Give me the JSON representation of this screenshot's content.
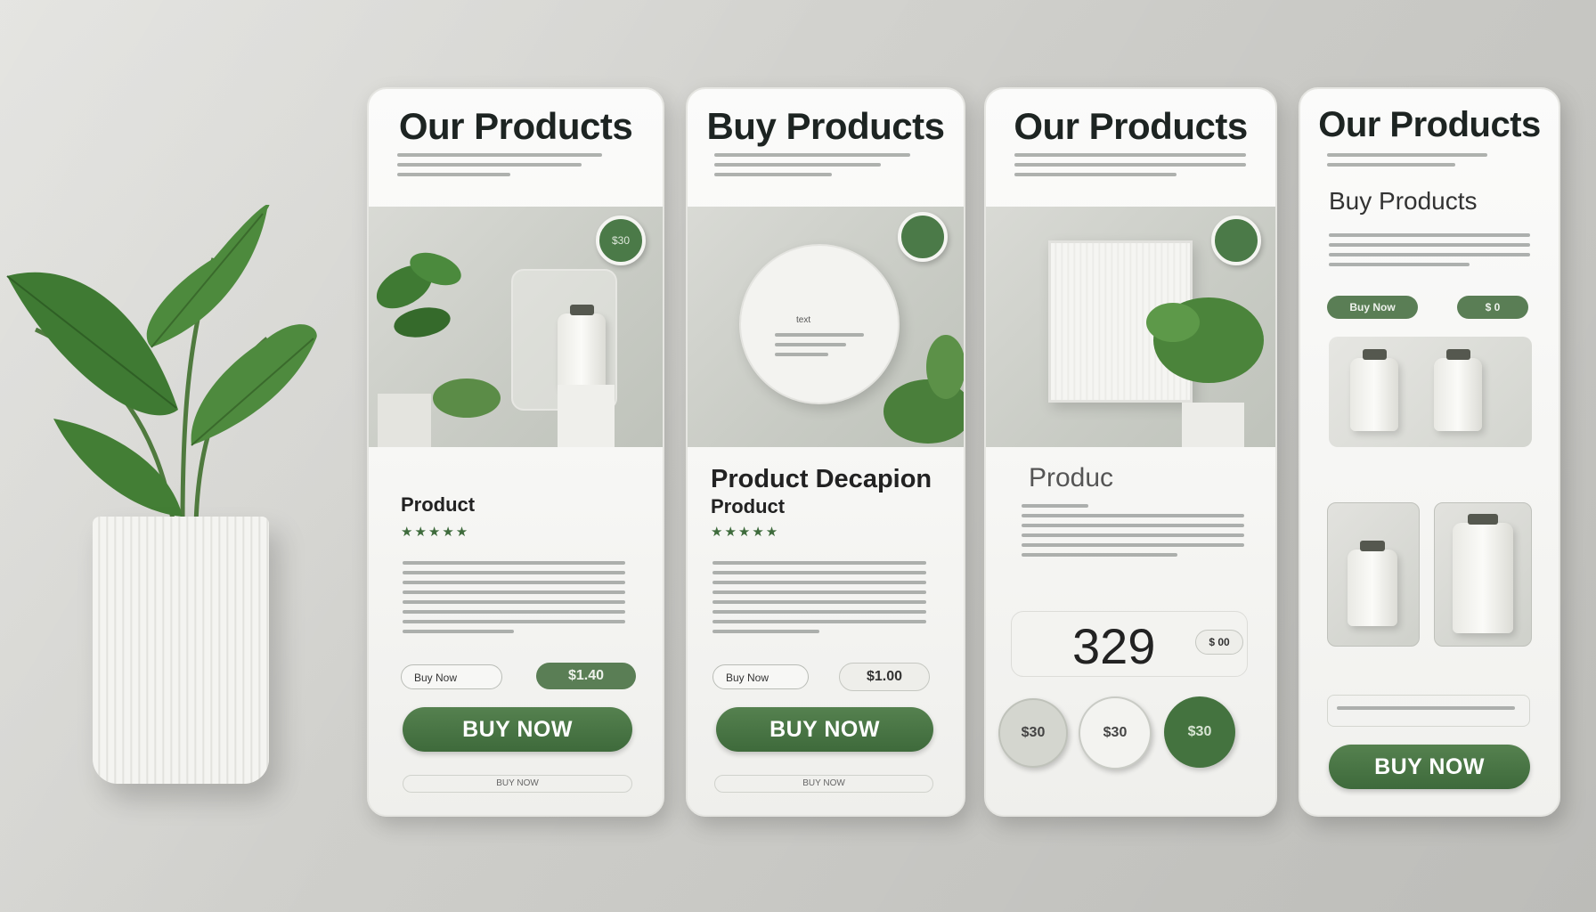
{
  "cards": [
    {
      "title": "Our Products",
      "badge": "$30",
      "product_name": "Product",
      "stars": "★★★★★",
      "small_button": "Buy Now",
      "price": "$1.40",
      "buy_button": "BUY NOW",
      "footer": "BUY NOW"
    },
    {
      "title": "Buy Products",
      "hero_label": "text",
      "product_heading": "Product Decapion",
      "product_name": "Product",
      "stars": "★★★★★",
      "small_button": "Buy Now",
      "price": "$1.00",
      "buy_button": "BUY NOW",
      "footer": "BUY NOW"
    },
    {
      "title": "Our Products",
      "product_name": "Produc",
      "price_big": "329",
      "price_small": "$ 00",
      "circle_left": "$30",
      "circle_mid": "$30",
      "circle_right": "$30"
    },
    {
      "title": "Our Products",
      "subtitle": "Buy Products",
      "pill_left": "Buy Now",
      "pill_right": "$ 0",
      "buy_button": "BUY NOW"
    }
  ],
  "colors": {
    "accent": "#4b7a48",
    "card": "#f6f6f4",
    "background": "#d3d3cf"
  }
}
